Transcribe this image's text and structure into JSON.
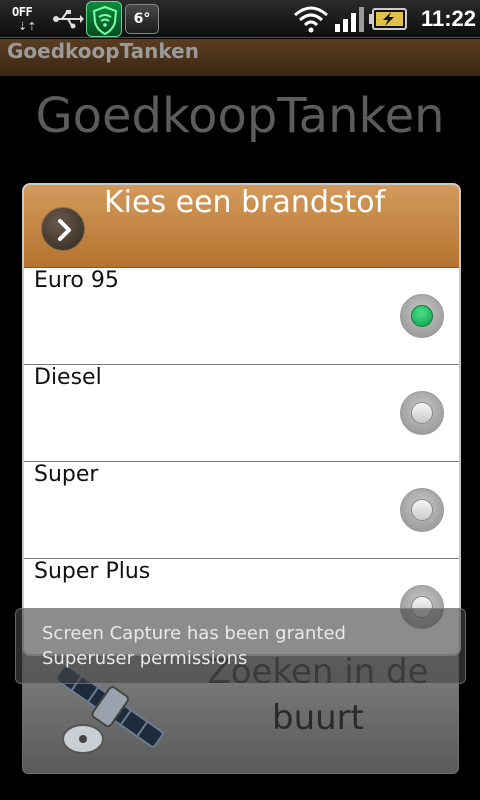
{
  "status_bar": {
    "off_badge": "OFF",
    "temperature": "6°",
    "time": "11:22",
    "icons": [
      "off-toggle-icon",
      "usb-icon",
      "shield-icon",
      "temperature-icon",
      "wifi-icon",
      "signal-icon",
      "battery-charging-icon"
    ]
  },
  "title_bar": {
    "title": "GoedkoopTanken"
  },
  "main": {
    "heading": "GoedkoopTanken",
    "nearby_button": {
      "line1": "Zoeken in de",
      "line2": "buurt",
      "icon": "satellite-icon"
    }
  },
  "dialog": {
    "title": "Kies een brandstof",
    "header_icon": "chevron-right-icon",
    "options": [
      {
        "label": "Euro 95",
        "checked": true
      },
      {
        "label": "Diesel",
        "checked": false
      },
      {
        "label": "Super",
        "checked": false
      },
      {
        "label": "Super Plus",
        "checked": false
      }
    ]
  },
  "toast": {
    "line1": "Screen Capture has been granted",
    "line2": "Superuser permissions"
  },
  "colors": {
    "header_accent": "#c4844a",
    "title_bar": "#4a3119",
    "radio_selected": "#1bb85e"
  }
}
